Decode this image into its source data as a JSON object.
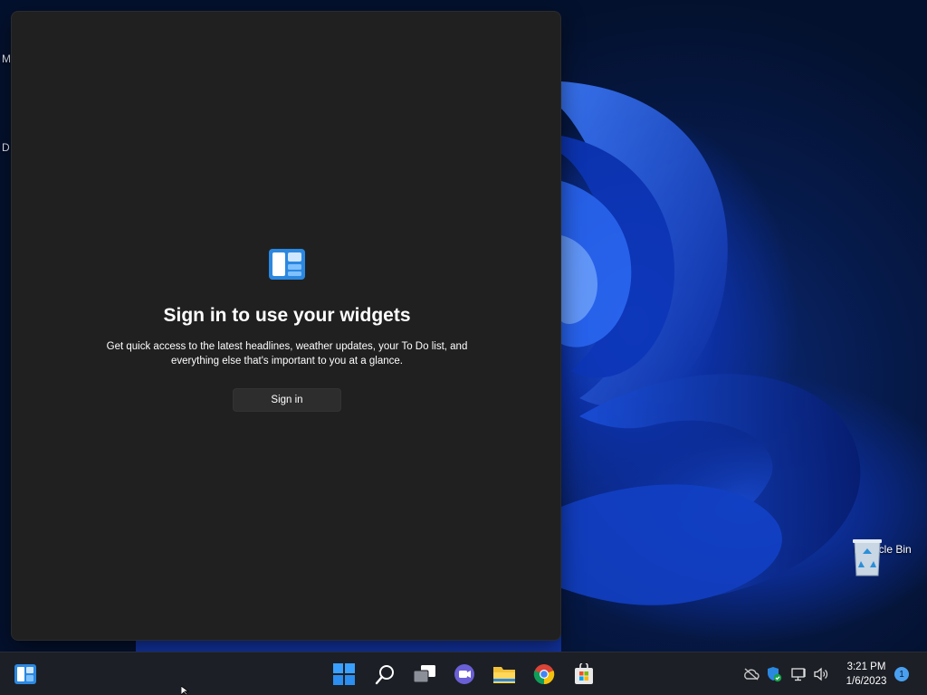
{
  "desktop": {
    "left_letters": [
      "M",
      "D"
    ],
    "recycle_bin_label": "Recycle Bin"
  },
  "widgets": {
    "title": "Sign in to use your widgets",
    "description_line1": "Get quick access to the latest headlines, weather updates, your To Do list, and",
    "description_line2": "everything else that's important to you at a glance.",
    "sign_in_label": "Sign in"
  },
  "taskbar": {
    "items": [
      "widgets-icon",
      "start-icon",
      "search-icon",
      "task-view-icon",
      "chat-icon",
      "file-explorer-icon",
      "chrome-icon",
      "store-icon"
    ],
    "tray": [
      "onedrive-icon",
      "security-icon",
      "network-icon",
      "volume-icon"
    ],
    "time": "3:21 PM",
    "date": "1/6/2023",
    "notification_count": "1"
  },
  "colors": {
    "panel_bg": "#202020",
    "taskbar_bg": "#1c1f26",
    "accent": "#4aa0f0",
    "wallpaper_blue": "#1a4fd6"
  }
}
